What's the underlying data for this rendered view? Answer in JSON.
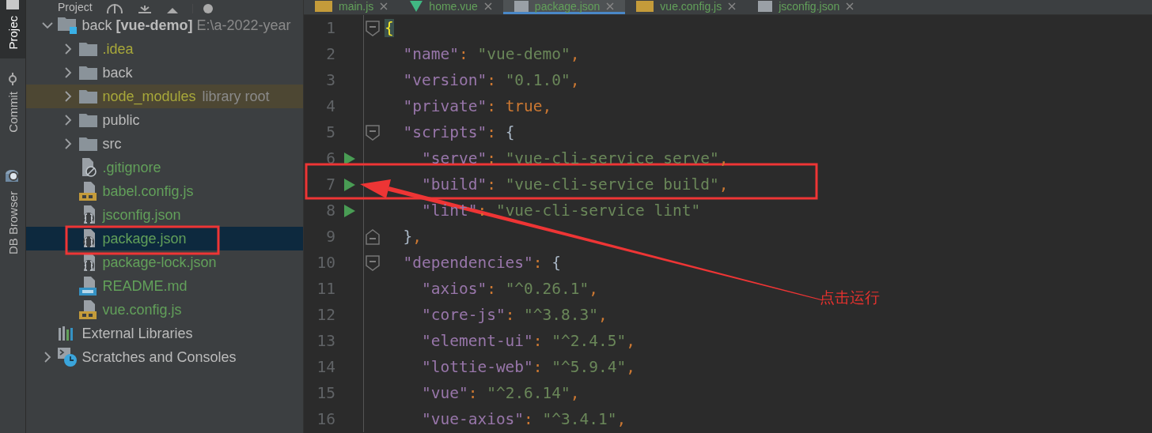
{
  "tool_strip": [
    {
      "label": "Projec",
      "kind": "project",
      "selected": true
    },
    {
      "label": "Commit",
      "kind": "commit",
      "selected": false
    },
    {
      "label": "DB Browser",
      "kind": "db",
      "selected": false
    }
  ],
  "project_panel": {
    "title": "Project",
    "tree": [
      {
        "name": "back **[vue-demo]**",
        "path": "E:\\a-2022-year",
        "kind": "module",
        "color": "#bbbbbb",
        "expanded": true,
        "selected": false,
        "library_root": false,
        "children": [
          {
            "name": ".idea",
            "kind": "folder",
            "color": "#a8a83a",
            "expanded": false,
            "selected": false,
            "library_root": false
          },
          {
            "name": "back",
            "kind": "folder",
            "color": "#bbbbbb",
            "expanded": false,
            "selected": false,
            "library_root": false
          },
          {
            "name": "node_modules",
            "hint": "library root",
            "kind": "folder",
            "color": "#a8a83a",
            "expanded": false,
            "selected": false,
            "library_root": true
          },
          {
            "name": "public",
            "kind": "folder",
            "color": "#bbbbbb",
            "expanded": false,
            "selected": false,
            "library_root": false
          },
          {
            "name": "src",
            "kind": "folder",
            "color": "#bbbbbb",
            "expanded": false,
            "selected": false,
            "library_root": false
          },
          {
            "name": ".gitignore",
            "kind": "ignore",
            "color": "#62a05a",
            "selected": false,
            "library_root": false
          },
          {
            "name": "babel.config.js",
            "kind": "js",
            "color": "#62a05a",
            "selected": false,
            "library_root": false
          },
          {
            "name": "jsconfig.json",
            "kind": "json",
            "color": "#62a05a",
            "selected": false,
            "library_root": false
          },
          {
            "name": "package.json",
            "kind": "json",
            "color": "#62a05a",
            "selected": true,
            "library_root": false
          },
          {
            "name": "package-lock.json",
            "kind": "json",
            "color": "#62a05a",
            "selected": false,
            "library_root": false
          },
          {
            "name": "README.md",
            "kind": "md",
            "color": "#62a05a",
            "selected": false,
            "library_root": false
          },
          {
            "name": "vue.config.js",
            "kind": "js",
            "color": "#62a05a",
            "selected": false,
            "library_root": false
          }
        ]
      },
      {
        "name": "External Libraries",
        "kind": "library",
        "color": "#bbbbbb",
        "selected": false,
        "library_root": false
      },
      {
        "name": "Scratches and Consoles",
        "kind": "scratch",
        "color": "#bbbbbb",
        "expanded": false,
        "selected": false,
        "library_root": false
      }
    ]
  },
  "editor": {
    "tabs": [
      {
        "label": "main.js",
        "kind": "js",
        "selected": false
      },
      {
        "label": "home.vue",
        "kind": "vue",
        "selected": false
      },
      {
        "label": "package.json",
        "kind": "json",
        "selected": true
      },
      {
        "label": "vue.config.js",
        "kind": "js",
        "selected": false
      },
      {
        "label": "jsconfig.json",
        "kind": "json",
        "selected": false
      }
    ],
    "lines": [
      {
        "number": "1",
        "kind": "fold-start",
        "runnable": false,
        "tokens": [
          {
            "kind": "match",
            "text": "{"
          }
        ]
      },
      {
        "number": "2",
        "runnable": false,
        "tokens": [
          {
            "kind": "key",
            "text": "  \"name\""
          },
          {
            "kind": "punct",
            "text": ": "
          },
          {
            "kind": "string",
            "text": "\"vue-demo\""
          },
          {
            "kind": "punct",
            "text": ","
          }
        ]
      },
      {
        "number": "3",
        "runnable": false,
        "tokens": [
          {
            "kind": "key",
            "text": "  \"version\""
          },
          {
            "kind": "punct",
            "text": ": "
          },
          {
            "kind": "string",
            "text": "\"0.1.0\""
          },
          {
            "kind": "punct",
            "text": ","
          }
        ]
      },
      {
        "number": "4",
        "runnable": false,
        "tokens": [
          {
            "kind": "key",
            "text": "  \"private\""
          },
          {
            "kind": "punct",
            "text": ": "
          },
          {
            "kind": "keyword",
            "text": "true"
          },
          {
            "kind": "punct",
            "text": ","
          }
        ]
      },
      {
        "number": "5",
        "kind": "fold-start",
        "runnable": false,
        "tokens": [
          {
            "kind": "key",
            "text": "  \"scripts\""
          },
          {
            "kind": "punct",
            "text": ": "
          },
          {
            "kind": "brace",
            "text": "{"
          }
        ]
      },
      {
        "number": "6",
        "runnable": true,
        "tokens": [
          {
            "kind": "key",
            "text": "    \"serve\""
          },
          {
            "kind": "punct",
            "text": ": "
          },
          {
            "kind": "string",
            "text": "\"vue-cli-service serve\""
          },
          {
            "kind": "punct",
            "text": ","
          }
        ]
      },
      {
        "number": "7",
        "runnable": true,
        "tokens": [
          {
            "kind": "key",
            "text": "    \"build\""
          },
          {
            "kind": "punct",
            "text": ": "
          },
          {
            "kind": "string",
            "text": "\"vue-cli-service build\""
          },
          {
            "kind": "punct",
            "text": ","
          }
        ]
      },
      {
        "number": "8",
        "runnable": true,
        "tokens": [
          {
            "kind": "key",
            "text": "    \"lint\""
          },
          {
            "kind": "punct",
            "text": ": "
          },
          {
            "kind": "string",
            "text": "\"vue-cli-service lint\""
          }
        ]
      },
      {
        "number": "9",
        "kind": "fold-end",
        "runnable": false,
        "tokens": [
          {
            "kind": "brace",
            "text": "  }"
          },
          {
            "kind": "punct",
            "text": ","
          }
        ]
      },
      {
        "number": "10",
        "kind": "fold-start",
        "runnable": false,
        "tokens": [
          {
            "kind": "key",
            "text": "  \"dependencies\""
          },
          {
            "kind": "punct",
            "text": ": "
          },
          {
            "kind": "brace",
            "text": "{"
          }
        ]
      },
      {
        "number": "11",
        "runnable": false,
        "tokens": [
          {
            "kind": "key",
            "text": "    \"axios\""
          },
          {
            "kind": "punct",
            "text": ": "
          },
          {
            "kind": "string",
            "text": "\"^0.26.1\""
          },
          {
            "kind": "punct",
            "text": ","
          }
        ]
      },
      {
        "number": "12",
        "runnable": false,
        "tokens": [
          {
            "kind": "key",
            "text": "    \"core-js\""
          },
          {
            "kind": "punct",
            "text": ": "
          },
          {
            "kind": "string",
            "text": "\"^3.8.3\""
          },
          {
            "kind": "punct",
            "text": ","
          }
        ]
      },
      {
        "number": "13",
        "runnable": false,
        "tokens": [
          {
            "kind": "key",
            "text": "    \"element-ui\""
          },
          {
            "kind": "punct",
            "text": ": "
          },
          {
            "kind": "string",
            "text": "\"^2.4.5\""
          },
          {
            "kind": "punct",
            "text": ","
          }
        ]
      },
      {
        "number": "14",
        "runnable": false,
        "tokens": [
          {
            "kind": "key",
            "text": "    \"lottie-web\""
          },
          {
            "kind": "punct",
            "text": ": "
          },
          {
            "kind": "string",
            "text": "\"^5.9.4\""
          },
          {
            "kind": "punct",
            "text": ","
          }
        ]
      },
      {
        "number": "15",
        "runnable": false,
        "tokens": [
          {
            "kind": "key",
            "text": "    \"vue\""
          },
          {
            "kind": "punct",
            "text": ": "
          },
          {
            "kind": "string",
            "text": "\"^2.6.14\""
          },
          {
            "kind": "punct",
            "text": ","
          }
        ]
      },
      {
        "number": "16",
        "runnable": false,
        "tokens": [
          {
            "kind": "key",
            "text": "    \"vue-axios\""
          },
          {
            "kind": "punct",
            "text": ": "
          },
          {
            "kind": "string",
            "text": "\"^3.4.1\""
          },
          {
            "kind": "punct",
            "text": ","
          }
        ]
      }
    ]
  },
  "annotation": {
    "label": "点击运行"
  }
}
